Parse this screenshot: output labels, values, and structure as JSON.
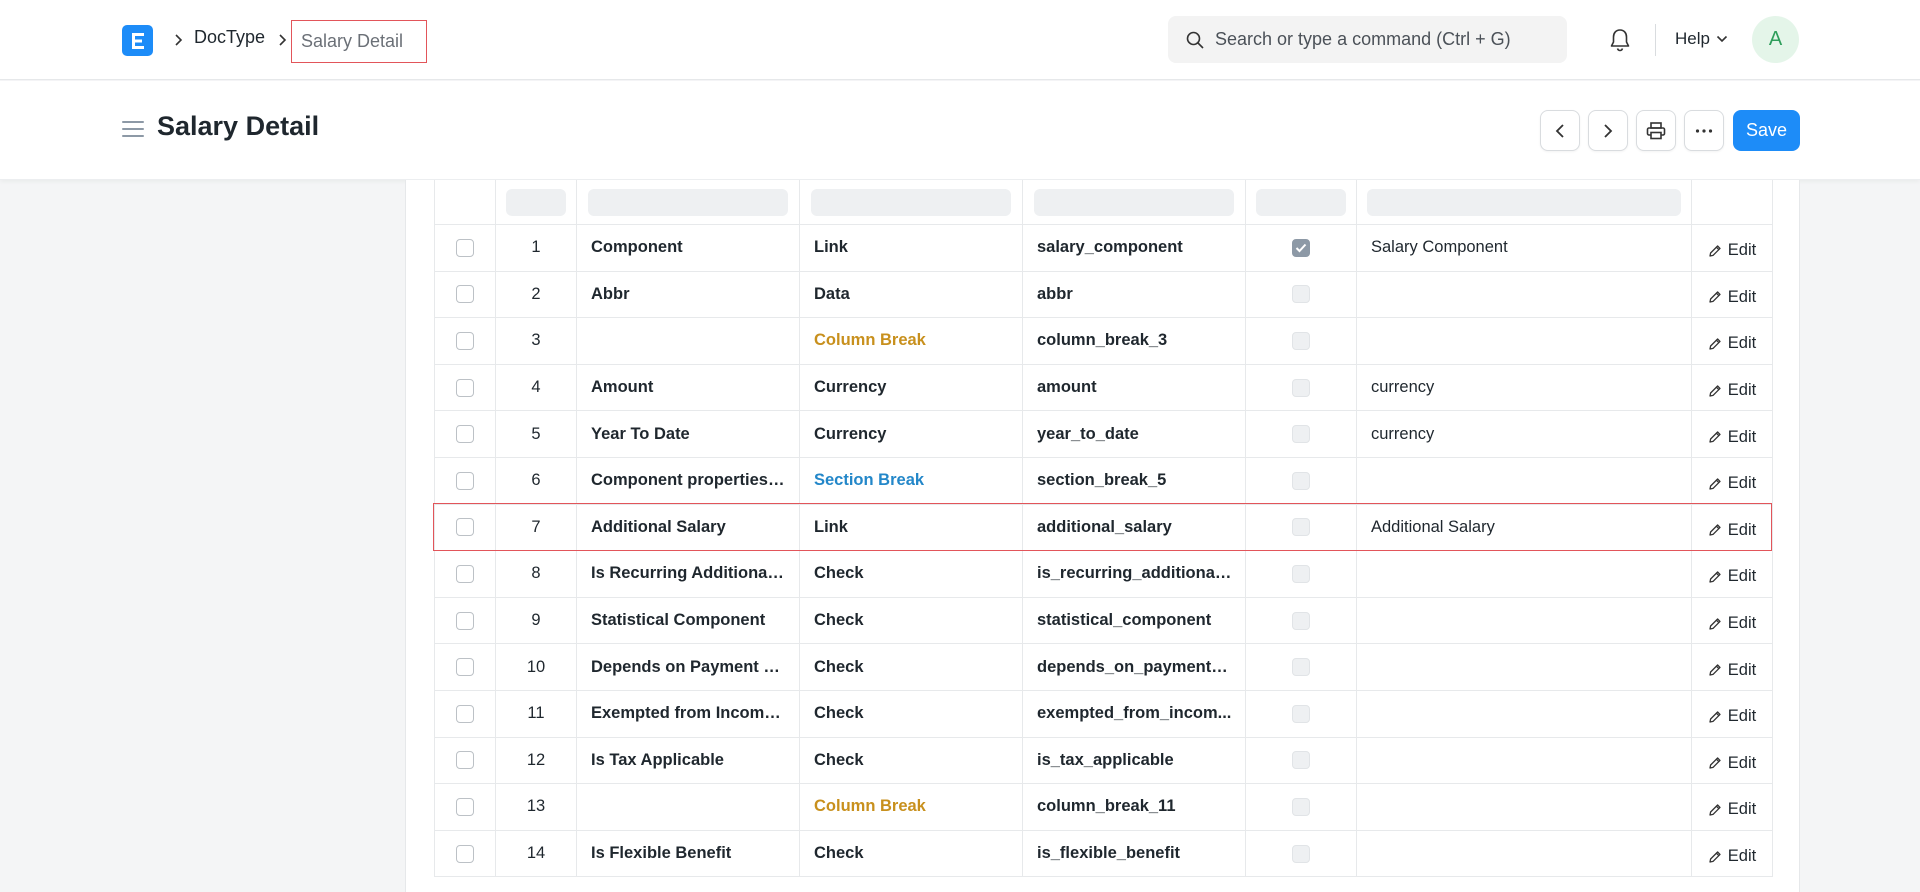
{
  "navbar": {
    "breadcrumb": [
      "DocType",
      "Salary Detail"
    ],
    "search_placeholder": "Search or type a command (Ctrl + G)",
    "help_label": "Help",
    "avatar_initial": "A"
  },
  "page": {
    "title": "Salary Detail",
    "save_label": "Save"
  },
  "colors": {
    "primary": "#1d8cf8",
    "column_break": "#c8901d",
    "section_break": "#2387c9",
    "highlight": "#e2555a"
  },
  "fields": {
    "edit_label": "Edit",
    "rows": [
      {
        "no": "1",
        "label": "Component",
        "type": "Link",
        "name": "salary_component",
        "mandatory": true,
        "options": "Salary Component"
      },
      {
        "no": "2",
        "label": "Abbr",
        "type": "Data",
        "name": "abbr",
        "mandatory": false,
        "options": ""
      },
      {
        "no": "3",
        "label": "",
        "type": "Column Break",
        "name": "column_break_3",
        "mandatory": false,
        "options": ""
      },
      {
        "no": "4",
        "label": "Amount",
        "type": "Currency",
        "name": "amount",
        "mandatory": false,
        "options": "currency"
      },
      {
        "no": "5",
        "label": "Year To Date",
        "type": "Currency",
        "name": "year_to_date",
        "mandatory": false,
        "options": "currency"
      },
      {
        "no": "6",
        "label": "Component properties ...",
        "type": "Section Break",
        "name": "section_break_5",
        "mandatory": false,
        "options": ""
      },
      {
        "no": "7",
        "label": "Additional Salary",
        "type": "Link",
        "name": "additional_salary",
        "mandatory": false,
        "options": "Additional Salary"
      },
      {
        "no": "8",
        "label": "Is Recurring Additional ...",
        "type": "Check",
        "name": "is_recurring_additional...",
        "mandatory": false,
        "options": ""
      },
      {
        "no": "9",
        "label": "Statistical Component",
        "type": "Check",
        "name": "statistical_component",
        "mandatory": false,
        "options": ""
      },
      {
        "no": "10",
        "label": "Depends on Payment D...",
        "type": "Check",
        "name": "depends_on_payment_...",
        "mandatory": false,
        "options": ""
      },
      {
        "no": "11",
        "label": "Exempted from Income...",
        "type": "Check",
        "name": "exempted_from_incom...",
        "mandatory": false,
        "options": ""
      },
      {
        "no": "12",
        "label": "Is Tax Applicable",
        "type": "Check",
        "name": "is_tax_applicable",
        "mandatory": false,
        "options": ""
      },
      {
        "no": "13",
        "label": "",
        "type": "Column Break",
        "name": "column_break_11",
        "mandatory": false,
        "options": ""
      },
      {
        "no": "14",
        "label": "Is Flexible Benefit",
        "type": "Check",
        "name": "is_flexible_benefit",
        "mandatory": false,
        "options": ""
      }
    ]
  }
}
